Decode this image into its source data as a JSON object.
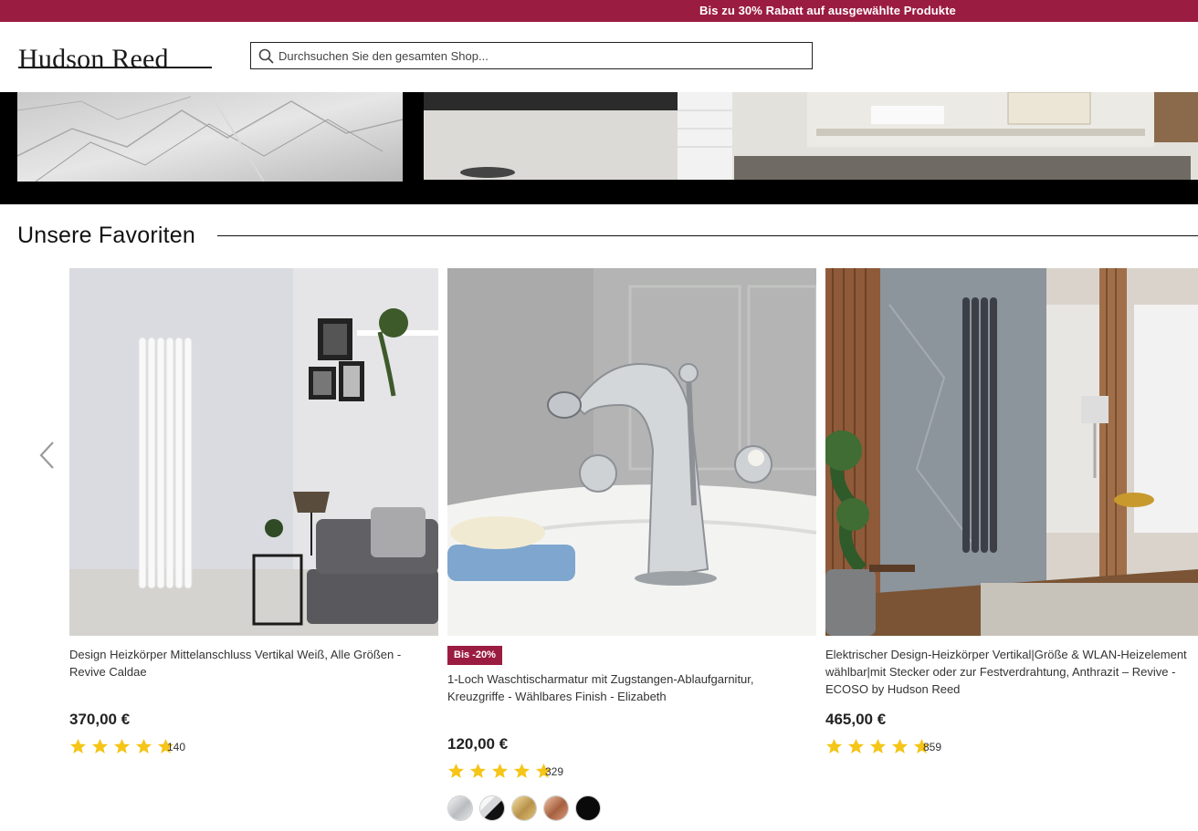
{
  "promo": {
    "text": "Bis zu 30% Rabatt auf ausgewählte Produkte"
  },
  "header": {
    "logo": "Hudson Reed",
    "search_placeholder": "Durchsuchen Sie den gesamten Shop..."
  },
  "favorites": {
    "title": "Unsere Favoriten",
    "products": [
      {
        "title": "Design Heizkörper Mittelanschluss Vertikal Weiß, Alle Größen - Revive Caldae",
        "price": "370,00 €",
        "rating_stars": 5,
        "reviews": "140",
        "badge": null
      },
      {
        "title": "1-Loch Waschtischarmatur mit Zugstangen-Ablaufgarnitur, Kreuzgriffe - Wählbares Finish - Elizabeth",
        "price": "120,00 €",
        "rating_stars": 5,
        "reviews": "329",
        "badge": "Bis -20%",
        "swatches": [
          "chrome",
          "chrome-black",
          "brushed-brass",
          "brushed-bronze",
          "black"
        ]
      },
      {
        "title": "Elektrischer Design-Heizkörper Vertikal|Größe & WLAN-Heizelement wählbar|mit Stecker oder zur Festverdrahtung, Anthrazit – Revive - ECOSO by Hudson Reed",
        "price": "465,00 €",
        "rating_stars": 5,
        "reviews": "859",
        "badge": null
      }
    ]
  },
  "colors": {
    "brand": "#9b1c41",
    "star": "#f5c518"
  },
  "icons": {
    "search": "search-icon",
    "prev": "chevron-left-icon",
    "star": "star-icon"
  }
}
